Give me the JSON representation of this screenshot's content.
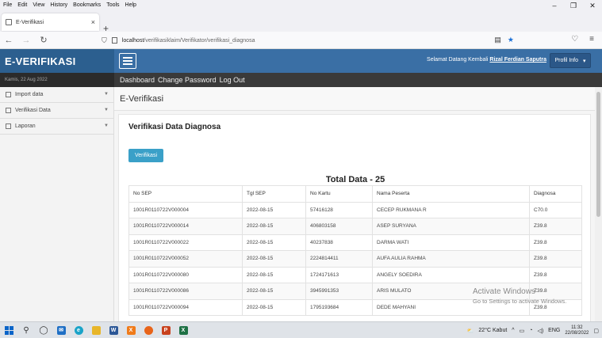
{
  "browser": {
    "menu": [
      "File",
      "Edit",
      "View",
      "History",
      "Bookmarks",
      "Tools",
      "Help"
    ],
    "tab_title": "E-Verifikasi",
    "url_host": "localhost",
    "url_path": "/verifikasiklaim/Verifikator/verifikasi_diagnosa"
  },
  "app": {
    "brand": "E-VERIFIKASI",
    "date": "Kamis, 22 Aug 2022",
    "welcome_prefix": "Selamat Datang Kembali",
    "user_name": "Rizal Ferdian Saputra",
    "profil_label": "Profil Info",
    "links": [
      "Dashboard",
      "Change Password",
      "Log Out"
    ],
    "sidebar": [
      {
        "label": "Import data",
        "icon": "list-icon"
      },
      {
        "label": "Verifikasi Data",
        "icon": "list-icon"
      },
      {
        "label": "Laporan",
        "icon": "list-icon"
      }
    ],
    "page_title": "E-Verifikasi",
    "panel_title": "Verifikasi Data Diagnosa",
    "verify_button": "Verifikasi",
    "total_label": "Total Data - 25"
  },
  "table": {
    "headers": [
      "No SEP",
      "Tgl SEP",
      "No Kartu",
      "Nama Peserta",
      "Diagnosa"
    ],
    "rows": [
      [
        "1001R0110722V000004",
        "2022-08-15",
        "57416128",
        "CECEP RUKMANA R",
        "C70.0"
      ],
      [
        "1001R0110722V000014",
        "2022-08-15",
        "406803158",
        "ASEP SURYANA",
        "Z39.8"
      ],
      [
        "1001R0110722V000022",
        "2022-08-15",
        "40237838",
        "DARMA WATI",
        "Z39.8"
      ],
      [
        "1001R0110722V000052",
        "2022-08-15",
        "2224814411",
        "AUFA AULIA RAHMA",
        "Z39.8"
      ],
      [
        "1001R0110722V000080",
        "2022-08-15",
        "1724171613",
        "ANGELY SOEDIRA",
        "Z39.8"
      ],
      [
        "1001R0110722V000086",
        "2022-08-15",
        "3945991353",
        "ARIS MULATO",
        "Z39.8"
      ],
      [
        "1001R0110722V000094",
        "2022-08-15",
        "1795193684",
        "DEDE MAHYANI",
        "Z39.8"
      ]
    ]
  },
  "watermark": {
    "line1": "Activate Windows",
    "line2": "Go to Settings to activate Windows."
  },
  "taskbar": {
    "weather": "22°C  Kabut",
    "lang": "ENG",
    "time": "11:32",
    "date": "22/08/2022"
  }
}
